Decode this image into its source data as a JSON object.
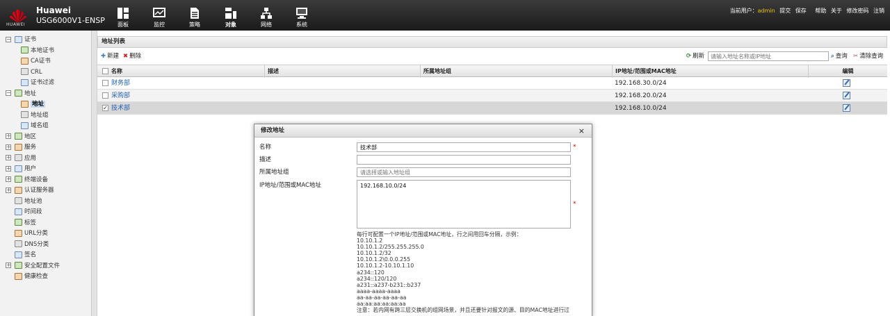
{
  "header": {
    "brand": "Huawei",
    "logo_text": "HUAWEI",
    "device": "USG6000V1-ENSP",
    "nav": [
      {
        "label": "面板",
        "icon": "dashboard-icon"
      },
      {
        "label": "监控",
        "icon": "monitor-icon"
      },
      {
        "label": "策略",
        "icon": "policy-icon"
      },
      {
        "label": "对象",
        "icon": "object-icon",
        "active": true
      },
      {
        "label": "网络",
        "icon": "network-icon"
      },
      {
        "label": "系统",
        "icon": "system-icon"
      }
    ],
    "current_user_label": "当前用户：",
    "current_user": "admin",
    "links": [
      "提交",
      "保存",
      "帮助",
      "关于",
      "修改密码",
      "注销"
    ]
  },
  "sidebar": {
    "items": [
      {
        "label": "证书",
        "level": 0,
        "expander": "−"
      },
      {
        "label": "本地证书",
        "level": 1
      },
      {
        "label": "CA证书",
        "level": 1
      },
      {
        "label": "CRL",
        "level": 1
      },
      {
        "label": "证书过滤",
        "level": 1
      },
      {
        "label": "地址",
        "level": 0,
        "expander": "−"
      },
      {
        "label": "地址",
        "level": 1,
        "selected": true
      },
      {
        "label": "地址组",
        "level": 1
      },
      {
        "label": "域名组",
        "level": 1
      },
      {
        "label": "地区",
        "level": 0,
        "expander": "+"
      },
      {
        "label": "服务",
        "level": 0,
        "expander": "+"
      },
      {
        "label": "应用",
        "level": 0,
        "expander": "+"
      },
      {
        "label": "用户",
        "level": 0,
        "expander": "+"
      },
      {
        "label": "终端设备",
        "level": 0,
        "expander": "+"
      },
      {
        "label": "认证服务器",
        "level": 0,
        "expander": "+"
      },
      {
        "label": "地址池",
        "level": 0
      },
      {
        "label": "时间段",
        "level": 0
      },
      {
        "label": "标签",
        "level": 0
      },
      {
        "label": "URL分类",
        "level": 0
      },
      {
        "label": "DNS分类",
        "level": 0
      },
      {
        "label": "签名",
        "level": 0
      },
      {
        "label": "安全配置文件",
        "level": 0,
        "expander": "+"
      },
      {
        "label": "健康检查",
        "level": 0
      }
    ]
  },
  "panel": {
    "title": "地址列表",
    "new_label": "新建",
    "delete_label": "删除",
    "refresh_label": "刷新",
    "search_placeholder": "请输入地址名称或IP地址",
    "query_label": "查询",
    "clear_label": "清除查询"
  },
  "table": {
    "columns": [
      "名称",
      "描述",
      "所属地址组",
      "IP地址/范围或MAC地址",
      "编辑"
    ],
    "rows": [
      {
        "name": "财务部",
        "description": "",
        "group": "",
        "address": "192.168.30.0/24",
        "checked": false
      },
      {
        "name": "采购部",
        "description": "",
        "group": "",
        "address": "192.168.20.0/24",
        "checked": false
      },
      {
        "name": "技术部",
        "description": "",
        "group": "",
        "address": "192.168.10.0/24",
        "checked": true
      }
    ]
  },
  "dialog": {
    "title": "修改地址",
    "name_label": "名称",
    "name_value": "技术部",
    "desc_label": "描述",
    "desc_value": "",
    "group_label": "所属地址组",
    "group_placeholder": "请选择或输入地址组",
    "ip_label": "IP地址/范围或MAC地址",
    "ip_value": "192.168.10.0/24",
    "required_mark": "*",
    "help_lines": [
      "每行可配置一个IP地址/范围或MAC地址，行之间用回车分隔，示例：",
      "10.10.1.2",
      "10.10.1.2/255.255.255.0",
      "10.10.1.2/32",
      "10.10.1.2\\0.0.0.255",
      "10.10.1.2-10.10.1.10",
      "a234::120",
      "a234::120/120",
      "a231::a237-b231::b237",
      "aaaa-aaaa-aaaa",
      "aa-aa-aa-aa-aa-aa",
      "aa:aa:aa:aa:aa:aa",
      "注意：若内网有跨三层交换机的组网场景，并且还要针对报文的源、目的MAC地址进行过"
    ]
  }
}
